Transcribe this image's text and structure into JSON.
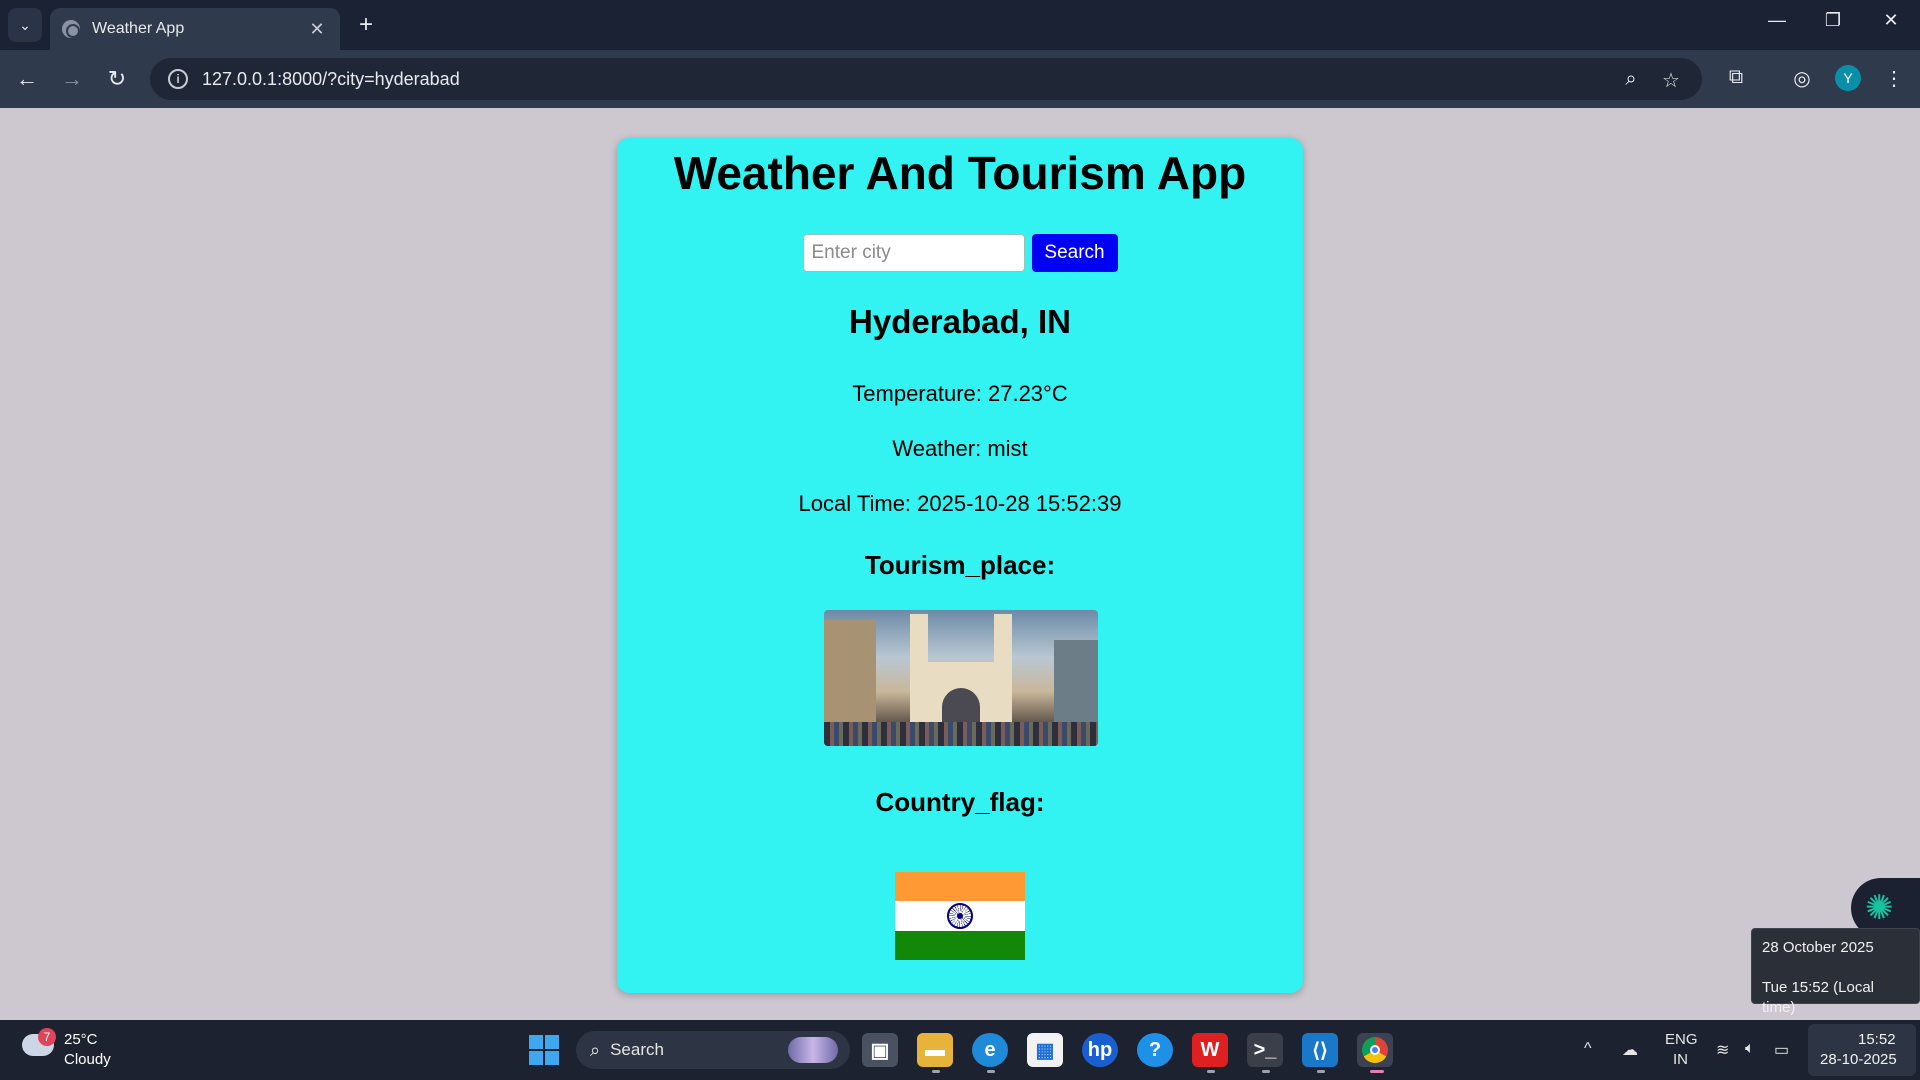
{
  "browser": {
    "tab_title": "Weather App",
    "tab_close": "✕",
    "new_tab": "+",
    "url": "127.0.0.1:8000/?city=hyderabad",
    "profile_initial": "Y"
  },
  "app": {
    "title": "Weather And Tourism App",
    "search": {
      "placeholder": "Enter city",
      "value": "",
      "button_label": "Search"
    },
    "city": "Hyderabad, IN",
    "temperature": "Temperature: 27.23°C",
    "weather": "Weather: mist",
    "local_time": "Local Time: 2025-10-28 15:52:39",
    "tourism_heading": "Tourism_place:",
    "flag_heading": "Country_flag:"
  },
  "tooltip": {
    "date": "28 October 2025",
    "local": "Tue 15:52 (Local time)"
  },
  "taskbar": {
    "weather_badge": "7",
    "weather_temp": "25°C",
    "weather_condition": "Cloudy",
    "search_label": "Search",
    "lang_top": "ENG",
    "lang_bottom": "IN",
    "clock_time": "15:52",
    "clock_date": "28-10-2025"
  },
  "colors": {
    "card_bg": "#33f2f2",
    "search_button": "#0000f2",
    "page_bg": "#cdc8d0"
  }
}
